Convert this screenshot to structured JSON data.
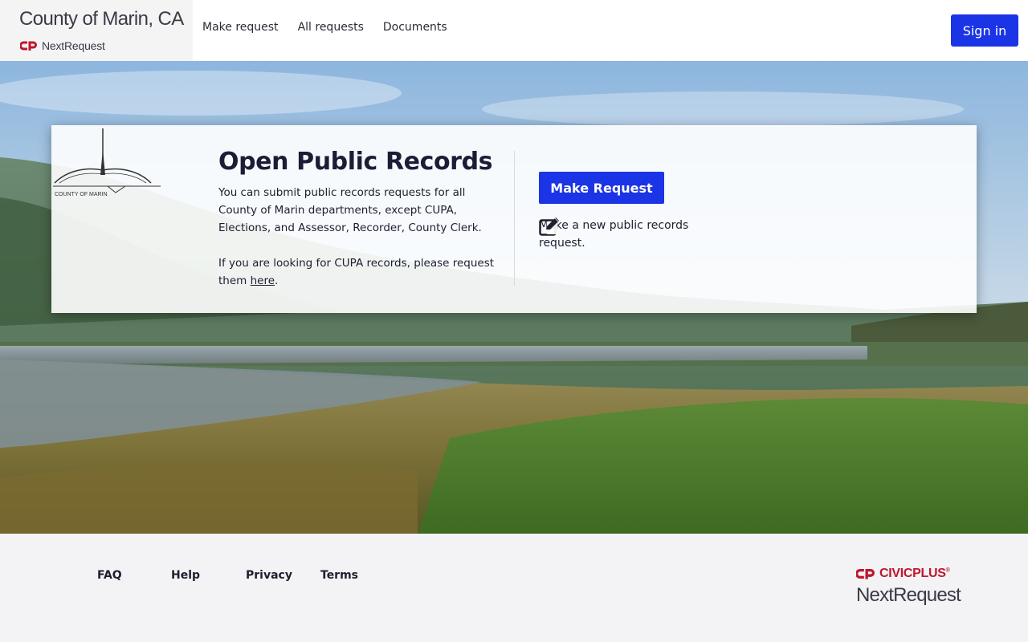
{
  "header": {
    "brand_title": "County of Marin, CA",
    "brand_product": "NextRequest",
    "nav": [
      {
        "label": "Make request"
      },
      {
        "label": "All requests"
      },
      {
        "label": "Documents"
      }
    ],
    "signin_label": "Sign in"
  },
  "card": {
    "logo_caption": "COUNTY OF MARIN",
    "title": "Open Public Records",
    "paragraph1": "You can submit public records requests for all County of Marin departments, except CUPA, Elections, and Assessor, Recorder, County Clerk.",
    "paragraph2_prefix": "If you are looking for CUPA records, please request them ",
    "paragraph2_link": "here",
    "paragraph2_suffix": ".",
    "button_label": "Make Request",
    "button_desc": "Make a new public records request."
  },
  "footer": {
    "links": [
      {
        "label": "FAQ"
      },
      {
        "label": "Help"
      },
      {
        "label": "Privacy"
      },
      {
        "label": "Terms"
      }
    ],
    "civic_brand": "CIVICPLUS",
    "civic_mark": "®",
    "product": "NextRequest"
  },
  "colors": {
    "accent": "#1a34e6",
    "brand_red": "#c0162e"
  },
  "icons": [
    "civicplus-logo-icon",
    "edit-icon",
    "county-seal-logo"
  ]
}
